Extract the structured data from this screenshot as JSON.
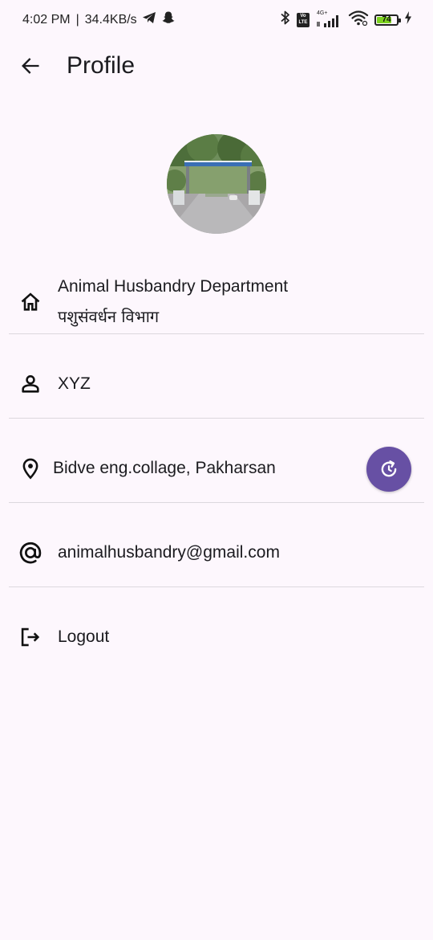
{
  "status_bar": {
    "time": "4:02 PM",
    "separator": "|",
    "network_speed": "34.4KB/s",
    "volte_top": "Vo",
    "volte_bottom": "LTE",
    "network_type": "4G+",
    "battery_level": "74",
    "battery_percent": 74
  },
  "app_bar": {
    "title": "Profile"
  },
  "profile": {
    "department_en": "Animal Husbandry Department",
    "department_mr": "पशुसंवर्धन विभाग",
    "name": "XYZ",
    "location": "Bidve eng.collage, Pakharsan",
    "email": "animalhusbandry@gmail.com",
    "logout_label": "Logout"
  },
  "colors": {
    "background": "#fdf7fd",
    "accent": "#6750a4",
    "divider": "#dcd8de",
    "battery_fill": "#7ed321"
  },
  "icons": {
    "back": "arrow-back-icon",
    "department": "home-icon",
    "name": "person-icon",
    "location": "location-pin-icon",
    "email": "at-sign-icon",
    "logout": "logout-icon",
    "refresh": "refresh-icon"
  }
}
